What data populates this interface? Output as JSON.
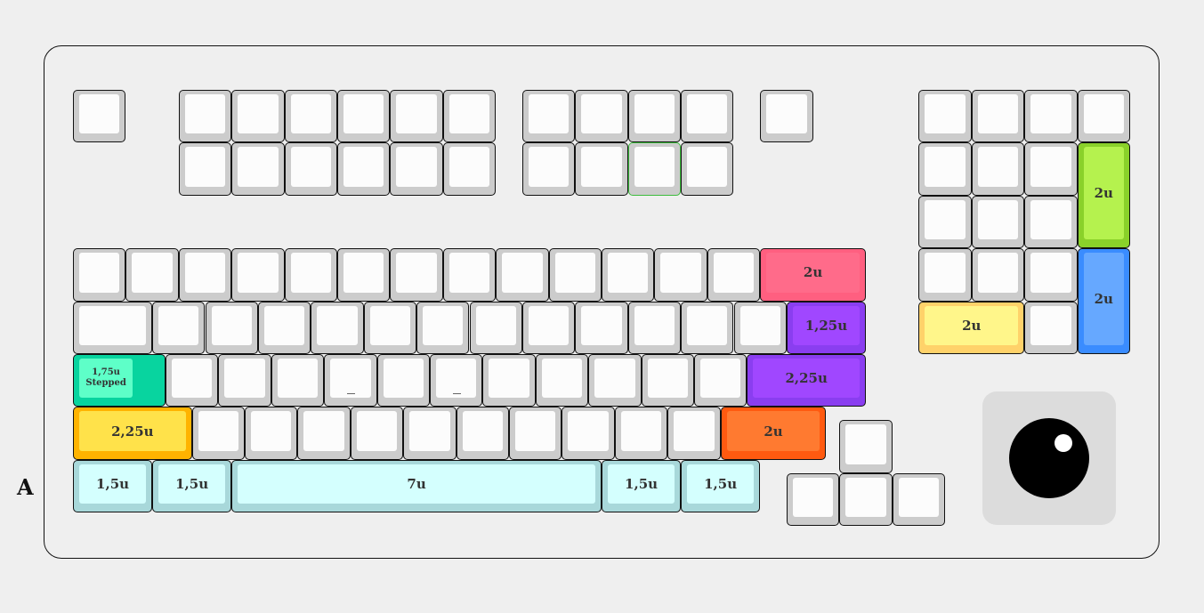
{
  "side_label": "A",
  "colors": {
    "default": {
      "outer": "#cccccc",
      "inner": "#fcfcfc"
    },
    "red": {
      "outer": "#ff5f80",
      "inner": "#ff6b8a"
    },
    "purple": {
      "outer": "#8a3ef0",
      "inner": "#a047ff"
    },
    "teal": {
      "outer": "#08d49f",
      "inner": "#5effc8"
    },
    "amber": {
      "outer": "#ffb300",
      "inner": "#ffe24a"
    },
    "orange": {
      "outer": "#ff5a10",
      "inner": "#ff7a30"
    },
    "cyan": {
      "outer": "#a8d8da",
      "inner": "#d4fffe"
    },
    "green": {
      "outer": "#8ad12a",
      "inner": "#b5f24e"
    },
    "blue": {
      "outer": "#3a8cff",
      "inner": "#66a8ff"
    },
    "lightyellow": {
      "outer": "#ffd26a",
      "inner": "#fff68a"
    }
  },
  "labels": {
    "backspace": "2u",
    "backslash": "1,25u",
    "caps": "1,75u\nStepped",
    "enter": "2,25u",
    "lshift": "2,25u",
    "rshift": "2u",
    "lctrl": "1,5u",
    "lalt": "1,5u",
    "space": "7u",
    "ralt": "1,5u",
    "rctrl": "1,5u",
    "numplus": "2u",
    "numenter": "2u",
    "num0": "2u"
  }
}
